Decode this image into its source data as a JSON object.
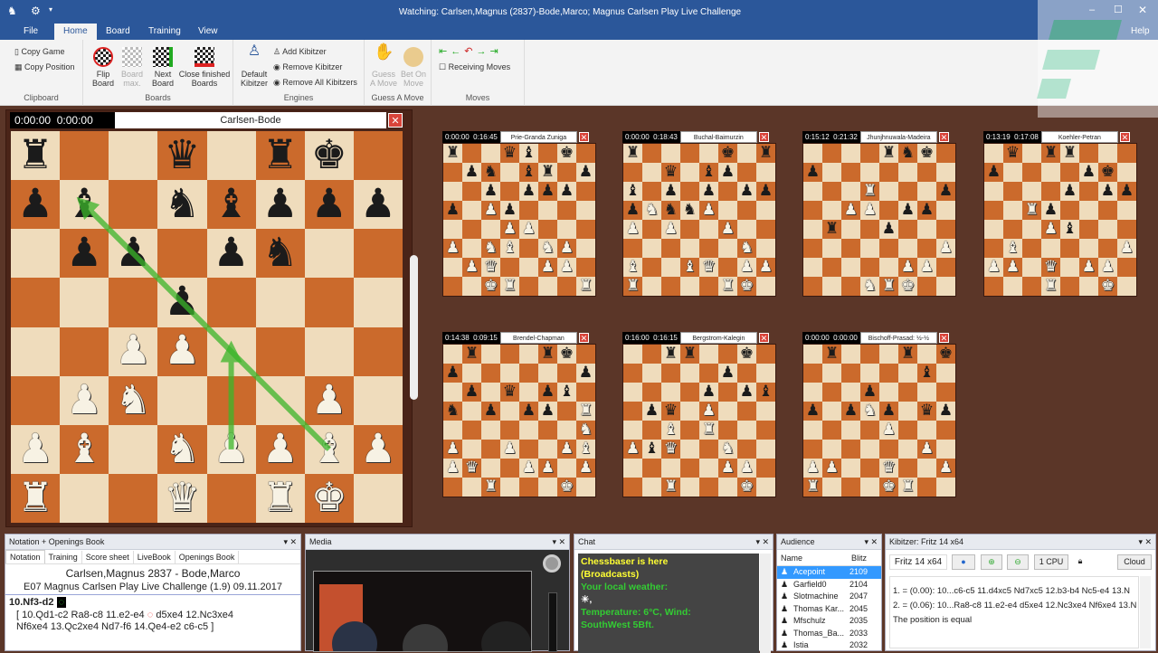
{
  "window": {
    "title": "Watching: Carlsen,Magnus (2837)-Bode,Marco; Magnus Carlsen Play Live Challenge",
    "help": "Help",
    "controls": [
      "minimize",
      "maximize",
      "close"
    ]
  },
  "ribbon_tabs": [
    {
      "label": "File"
    },
    {
      "label": "Home",
      "selected": true
    },
    {
      "label": "Board"
    },
    {
      "label": "Training"
    },
    {
      "label": "View"
    }
  ],
  "ribbon": {
    "clipboard": {
      "label": "Clipboard",
      "copy_game": "Copy Game",
      "copy_position": "Copy Position"
    },
    "boards": {
      "label": "Boards",
      "flip": "Flip Board",
      "board_max": "Board max.",
      "next": "Next Board",
      "close_finished": "Close finished Boards"
    },
    "engines": {
      "label": "Engines",
      "default_kibitzer": "Default Kibitzer",
      "add": "Add Kibitzer",
      "remove": "Remove Kibitzer",
      "remove_all": "Remove All Kibitzers"
    },
    "guess": {
      "label": "Guess A Move",
      "guess_a_move": "Guess A Move",
      "bet_on_move": "Bet On Move"
    },
    "moves": {
      "label": "Moves",
      "receiving": "Receiving Moves",
      "receiving_checked": false,
      "nav": [
        "first-move",
        "previous-move",
        "take-back",
        "next-move",
        "last-move"
      ]
    }
  },
  "main_board": {
    "clock_white": "0:00:00",
    "clock_black": "0:00:00",
    "name": "Carlsen-Bode",
    "fen": "r2q1rk1/pb1nbppp/1pp1pn2/3p4/2PP4/1PN3P1/PB1NPPBP/R2Q1RK1",
    "arrows": [
      [
        "e2",
        "e4"
      ],
      [
        "g2",
        "b7"
      ]
    ],
    "arrow_color": "#3bb52a"
  },
  "boards": [
    {
      "c1": "0:00:00",
      "c1red": true,
      "c2": "0:16:45",
      "name": "Prie-Granda Zuniga",
      "fen": "r2qb1k1/1pn1br1p/2p1ppp1/p1Pp4/3PP3/P1NB1NP1/1PQ2PP1/2KR3R"
    },
    {
      "c1": "0:00:00",
      "c1red": true,
      "c2": "0:18:43",
      "name": "Buchal-Baimurzin",
      "fen": "r4k1r/2q1bp2/b1p1p1pp/pNnnP3/P1P2P2/6N1/B2BQ1PP/R4RK1"
    },
    {
      "c1": "0:15:12",
      "c2": "0:21:32",
      "name": "Jhunjhnuwala-Madeira",
      "fen": "4rnk1/p7/3R3p/2PP1pp1/1r2p3/7P/5PP1/3NRK2"
    },
    {
      "c1": "0:13:19",
      "c2": "0:17:08",
      "name": "Koehler-Petran",
      "fen": "1q1rr3/p4pk1/4p1pp/2Rp4/3Pb3/1B5P/PP1Q1PP1/3R2K1"
    },
    {
      "c1": "0:14:38",
      "c2": "0:09:15",
      "name": "Brendel-Chapman",
      "fen": "1r3rk1/p6p/1p1q1pb1/n1p1pp1R/7N/P2P2PB/PQ2PP1P/2R3K1"
    },
    {
      "c1": "0:16:00",
      "c2": "0:16:15",
      "name": "Bergstrom-Kalegin",
      "fen": "2rr2k1/5p2/4p1pb/1pq1P3/2B1R3/PbQ2N2/5PP1/2R3K1"
    },
    {
      "c1": "0:00:00",
      "c1red": true,
      "c2": "0:00:00",
      "c2red": true,
      "name": "Bischoff-Prasad: ½-½",
      "fen": "1r3r1k/6b1/3p4/p1pNp1qp/4P3/6P1/PP2Q2P/R3KR2"
    }
  ],
  "notation": {
    "title": "Notation + Openings Book",
    "tabs": [
      "Notation",
      "Training",
      "Score sheet",
      "LiveBook",
      "Openings Book"
    ],
    "players": "Carlsen,Magnus 2837 - Bode,Marco",
    "event": "E07 Magnus Carlsen Play Live Challenge (1.9) 09.11.2017",
    "current_move": "10.Nf3-d2",
    "variation_line1": "[ 10.Qd1-c2  Ra8-c8  11.e2-e4",
    "variation_line1b": "d5xe4  12.Nc3xe4",
    "variation_line2": "Nf6xe4  13.Qc2xe4  Nd7-f6  14.Qe4-e2  c6-c5 ]"
  },
  "media": {
    "title": "Media"
  },
  "chat": {
    "title": "Chat",
    "lines": [
      {
        "text": "Chessbaser is here",
        "color": "#ffff33"
      },
      {
        "text": "(Broadcasts)",
        "color": "#ffff33"
      },
      {
        "text": "Your local weather:",
        "color": "#33cc33"
      },
      {
        "text": "☀,",
        "color": "#ffffff"
      },
      {
        "text": "Temperature: 6°C, Wind:",
        "color": "#33cc33"
      },
      {
        "text": "SouthWest 5Bft.",
        "color": "#33cc33"
      }
    ]
  },
  "audience": {
    "title": "Audience",
    "col_name": "Name",
    "col_rating": "Blitz",
    "rows": [
      {
        "name": "Acepoint",
        "rating": "2109",
        "selected": true
      },
      {
        "name": "Garfield0",
        "rating": "2104"
      },
      {
        "name": "Slotmachine",
        "rating": "2047"
      },
      {
        "name": "Thomas Kar...",
        "rating": "2045"
      },
      {
        "name": "Mfschulz",
        "rating": "2035"
      },
      {
        "name": "Thomas_Ba...",
        "rating": "2033"
      },
      {
        "name": "Istia",
        "rating": "2032"
      }
    ]
  },
  "kibitzer": {
    "title": "Kibitzer: Fritz 14 x64",
    "engine": "Fritz 14 x64",
    "cpu": "1 CPU",
    "cloud": "Cloud",
    "lines": [
      "1. = (0.00): 10...c6-c5 11.d4xc5 Nd7xc5 12.b3-b4 Nc5-e4 13.N",
      "2. = (0.06): 10...Ra8-c8 11.e2-e4 d5xe4 12.Nc3xe4 Nf6xe4 13.N",
      "The position is equal"
    ]
  },
  "colors": {
    "accent": "#2b579a",
    "light_square": "#efdcbc",
    "dark_square": "#cb6a2c",
    "selection": "#3399ff"
  }
}
